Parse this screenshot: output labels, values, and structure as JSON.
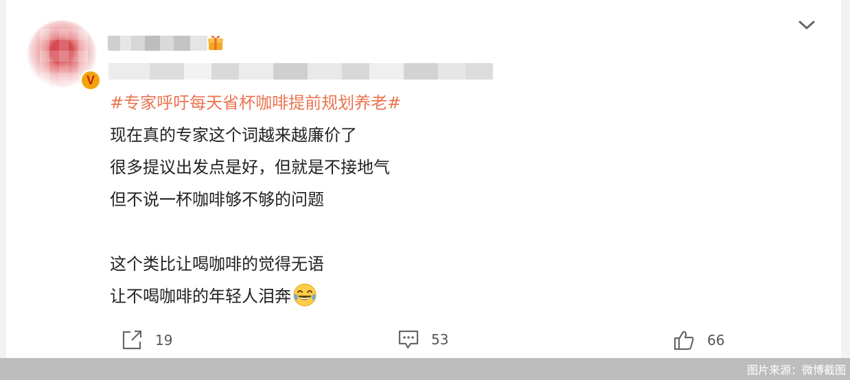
{
  "post": {
    "hashtag": "#专家呼吁每天省杯咖啡提前规划养老#",
    "lines": [
      "现在真的专家这个词越来越廉价了",
      "很多提议出发点是好，但就是不接地气",
      "但不说一杯咖啡够不够的问题",
      "",
      "这个类比让喝咖啡的觉得无语",
      "让不喝咖啡的年轻人泪奔"
    ],
    "emoji": "laughing-crying-emoji"
  },
  "actions": {
    "repost_count": "19",
    "comment_count": "53",
    "like_count": "66"
  },
  "icons": {
    "menu": "chevron-down-icon",
    "verified": "verified-badge-icon",
    "vip": "vip-gift-icon",
    "repost": "repost-icon",
    "comment": "comment-icon",
    "like": "thumbs-up-icon"
  },
  "watermark": "图片来源：微博截图",
  "colors": {
    "hashtag": "#eb7350",
    "text": "#222222",
    "verified_badge": "#f3a40c"
  }
}
